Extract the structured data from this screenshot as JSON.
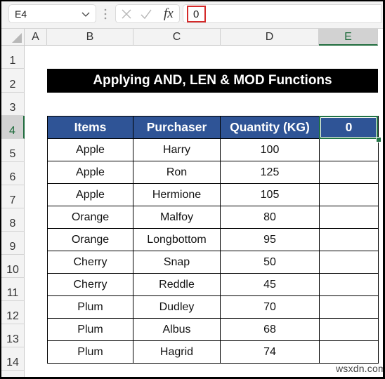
{
  "formula_bar": {
    "name_box": "E4",
    "formula_value": "0",
    "fx_label": "fx"
  },
  "columns": [
    "A",
    "B",
    "C",
    "D",
    "E"
  ],
  "selected_column": "E",
  "rows": [
    "1",
    "2",
    "3",
    "4",
    "5",
    "6",
    "7",
    "8",
    "9",
    "10",
    "11",
    "12",
    "13",
    "14"
  ],
  "selected_row": "4",
  "sheet": {
    "title": "Applying AND, LEN & MOD Functions",
    "table": {
      "headers": [
        "Items",
        "Purchaser",
        "Quantity (KG)",
        "0"
      ],
      "rows": [
        [
          "Apple",
          "Harry",
          "100",
          ""
        ],
        [
          "Apple",
          "Ron",
          "125",
          ""
        ],
        [
          "Apple",
          "Hermione",
          "105",
          ""
        ],
        [
          "Orange",
          "Malfoy",
          "80",
          ""
        ],
        [
          "Orange",
          "Longbottom",
          "95",
          ""
        ],
        [
          "Cherry",
          "Snap",
          "50",
          ""
        ],
        [
          "Cherry",
          "Reddle",
          "45",
          ""
        ],
        [
          "Plum",
          "Dudley",
          "70",
          ""
        ],
        [
          "Plum",
          "Albus",
          "68",
          ""
        ],
        [
          "Plum",
          "Hagrid",
          "74",
          ""
        ]
      ]
    }
  },
  "colors": {
    "header_fill": "#2f5496",
    "title_fill": "#000000",
    "selection": "#217346",
    "highlight": "#d42a2a"
  },
  "watermark": "wsxdn.com"
}
